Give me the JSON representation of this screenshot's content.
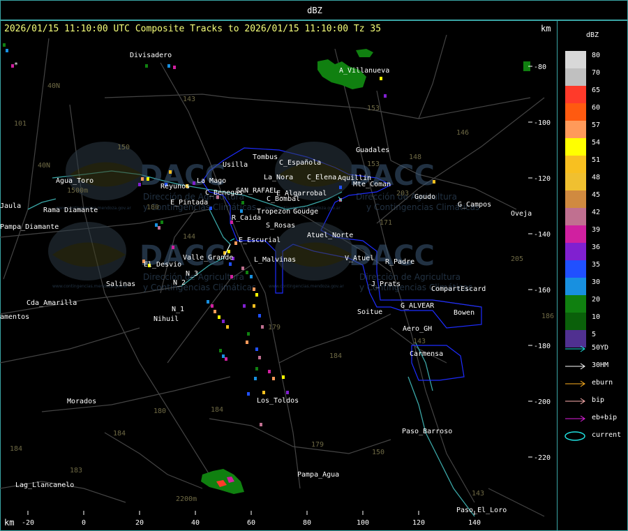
{
  "window": {
    "title": "dBZ"
  },
  "header": {
    "text": "2026/01/15 11:10:00 UTC Composite Tracks to 2026/01/15 11:10:00 Tz 35",
    "km_top": "km",
    "km_bottom": "km"
  },
  "axes": {
    "x_ticks": [
      "-20",
      "0",
      "20",
      "40",
      "60",
      "80",
      "100",
      "120",
      "140"
    ],
    "y_ticks": [
      "-80",
      "-100",
      "-120",
      "-140",
      "-160",
      "-180",
      "-200",
      "-220"
    ]
  },
  "legend": {
    "title": "dBZ",
    "items": [
      {
        "label": "80",
        "color": "#d8d8d8"
      },
      {
        "label": "70",
        "color": "#c0c0c0"
      },
      {
        "label": "65",
        "color": "#ff3a2a"
      },
      {
        "label": "60",
        "color": "#ff5a10"
      },
      {
        "label": "57",
        "color": "#ff9a5a"
      },
      {
        "label": "54",
        "color": "#ffff00"
      },
      {
        "label": "51",
        "color": "#f8c020"
      },
      {
        "label": "48",
        "color": "#f0c030"
      },
      {
        "label": "45",
        "color": "#d08a40"
      },
      {
        "label": "42",
        "color": "#c07090"
      },
      {
        "label": "39",
        "color": "#d020a0"
      },
      {
        "label": "36",
        "color": "#8020d0"
      },
      {
        "label": "35",
        "color": "#2050ff"
      },
      {
        "label": "30",
        "color": "#1890e0"
      },
      {
        "label": "20",
        "color": "#108010"
      },
      {
        "label": "10",
        "color": "#0a600a"
      },
      {
        "label": "5",
        "color": "#503090"
      }
    ],
    "tracks": [
      {
        "label": "50YD",
        "color": "#20e0e0"
      },
      {
        "label": "30HM",
        "color": "#ffffff"
      },
      {
        "label": "eburn",
        "color": "#ffb020"
      },
      {
        "label": "bip",
        "color": "#ffb0b0"
      },
      {
        "label": "eb+bip",
        "color": "#e020e0"
      },
      {
        "label": "current",
        "color": "#20e0e0"
      }
    ]
  },
  "places": [
    {
      "name": "Divisadero"
    },
    {
      "name": "A_Villanueva"
    },
    {
      "name": "Guadales"
    },
    {
      "name": "Tombus"
    },
    {
      "name": "Usilla"
    },
    {
      "name": "C_Española"
    },
    {
      "name": "La_Nora"
    },
    {
      "name": "C_Elena"
    },
    {
      "name": "Aquillin"
    },
    {
      "name": "Mte_Coman"
    },
    {
      "name": "Goudo"
    },
    {
      "name": "G_Campos"
    },
    {
      "name": "Oveja"
    },
    {
      "name": "Agua_Toro"
    },
    {
      "name": "Rama Diamante"
    },
    {
      "name": "Reyunos"
    },
    {
      "name": "La Mago"
    },
    {
      "name": "C_Benegas"
    },
    {
      "name": "SAN_RAFAEL"
    },
    {
      "name": "E_Algarrobal"
    },
    {
      "name": "C_Bombal"
    },
    {
      "name": "E_Pintada"
    },
    {
      "name": "Jaula"
    },
    {
      "name": "Tropezon"
    },
    {
      "name": "Goudge"
    },
    {
      "name": "R_Caida"
    },
    {
      "name": "S_Rosas"
    },
    {
      "name": "Pampa_Diamante"
    },
    {
      "name": "Atuel_Norte"
    },
    {
      "name": "E_Escurial"
    },
    {
      "name": "V_Atuel"
    },
    {
      "name": "R_Padre"
    },
    {
      "name": "Valle_Grande"
    },
    {
      "name": "L_Malvinas"
    },
    {
      "name": "El_Desvio"
    },
    {
      "name": "N_3"
    },
    {
      "name": "Salinas"
    },
    {
      "name": "N_2"
    },
    {
      "name": "J_Prats"
    },
    {
      "name": "CompartEscard"
    },
    {
      "name": "Cda_Amarilla"
    },
    {
      "name": "N_1"
    },
    {
      "name": "G_ALVEAR"
    },
    {
      "name": "Soitue"
    },
    {
      "name": "Bowen"
    },
    {
      "name": "amentos"
    },
    {
      "name": "Nihuil"
    },
    {
      "name": "Aero_GH"
    },
    {
      "name": "Carmensa"
    },
    {
      "name": "Morados"
    },
    {
      "name": "Los_Toldos"
    },
    {
      "name": "Paso_Barroso"
    },
    {
      "name": "Pampa_Agua"
    },
    {
      "name": "Lag_Llancanelo"
    },
    {
      "name": "Paso_El_Loro"
    }
  ],
  "routes": [
    {
      "label": "143"
    },
    {
      "label": "153"
    },
    {
      "label": "101"
    },
    {
      "label": "40N"
    },
    {
      "label": "150"
    },
    {
      "label": "146"
    },
    {
      "label": "148"
    },
    {
      "label": "153"
    },
    {
      "label": "203"
    },
    {
      "label": "144"
    },
    {
      "label": "171"
    },
    {
      "label": "180"
    },
    {
      "label": "205"
    },
    {
      "label": "179"
    },
    {
      "label": "184"
    },
    {
      "label": "180"
    },
    {
      "label": "184"
    },
    {
      "label": "179"
    },
    {
      "label": "150"
    },
    {
      "label": "143"
    },
    {
      "label": "184"
    },
    {
      "label": "183"
    },
    {
      "label": "184"
    },
    {
      "label": "143"
    },
    {
      "label": "40N"
    },
    {
      "label": "1500m"
    },
    {
      "label": "2200m"
    },
    {
      "label": "186"
    }
  ],
  "watermark": {
    "brand": "DACC",
    "line1": "Dirección de Agricultura",
    "line2": "y Contingencias Climáticas",
    "url": "www.contingencias.mendoza.gov.ar"
  },
  "map_colors": {
    "background": "#000000",
    "roads": "#4a4a4a",
    "departments": "#1d2cff",
    "rivers": "#3aa6a6",
    "frame": "#3aa6a6",
    "header_text": "#f6ff7a"
  }
}
